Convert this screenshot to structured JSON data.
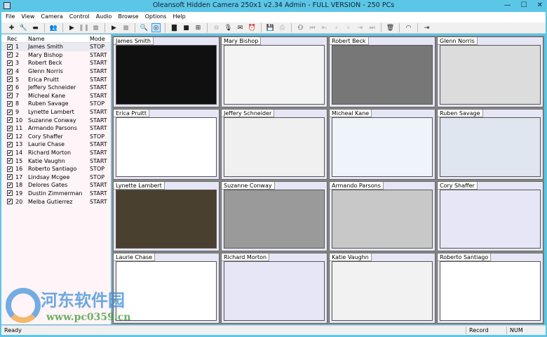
{
  "window": {
    "title": "Oleansoft Hidden Camera 250x1 v2.34 Admin - FULL VERSION - 250 PCs",
    "controls": [
      "—",
      "☐",
      "✕"
    ]
  },
  "menu": [
    "File",
    "View",
    "Camera",
    "Control",
    "Audio",
    "Browse",
    "Options",
    "Help"
  ],
  "toolbar": [
    "add-icon",
    "settings-icon",
    "remove-icon",
    "users-icon",
    "play-icon",
    "pause-icon",
    "stop-icon",
    "play-all-icon",
    "stop-all-icon",
    "zoom-icon",
    "disc-icon",
    "layout-1-icon",
    "layout-small-icon",
    "layout-4-icon",
    "link-icon",
    "microphone-icon",
    "mail-icon",
    "alarm-icon",
    "save-icon",
    "print-icon",
    "binoculars-icon",
    "first-icon",
    "prev-page-icon",
    "prev-icon",
    "next-icon",
    "next-page-icon",
    "last-icon",
    "trash-icon",
    "eye-icon",
    "exit-icon"
  ],
  "list": {
    "headers": [
      "Rec",
      "Name",
      "Mode"
    ],
    "rows": [
      {
        "n": "1",
        "name": "James Smith",
        "mode": "STOP"
      },
      {
        "n": "2",
        "name": "Mary Bishop",
        "mode": "START"
      },
      {
        "n": "3",
        "name": "Robert Beck",
        "mode": "START"
      },
      {
        "n": "4",
        "name": "Glenn Norris",
        "mode": "START"
      },
      {
        "n": "5",
        "name": "Erica Pruitt",
        "mode": "START"
      },
      {
        "n": "6",
        "name": "Jeffery Schneider",
        "mode": "START"
      },
      {
        "n": "7",
        "name": "Micheal Kane",
        "mode": "START"
      },
      {
        "n": "8",
        "name": "Ruben Savage",
        "mode": "STOP"
      },
      {
        "n": "9",
        "name": "Lynette Lambert",
        "mode": "START"
      },
      {
        "n": "10",
        "name": "Suzanne Conway",
        "mode": "START"
      },
      {
        "n": "11",
        "name": "Armando Parsons",
        "mode": "START"
      },
      {
        "n": "12",
        "name": "Cory Shaffer",
        "mode": "STOP"
      },
      {
        "n": "13",
        "name": "Laurie Chase",
        "mode": "START"
      },
      {
        "n": "14",
        "name": "Richard Morton",
        "mode": "START"
      },
      {
        "n": "15",
        "name": "Katie Vaughn",
        "mode": "START"
      },
      {
        "n": "16",
        "name": "Roberto Santiago",
        "mode": "STOP"
      },
      {
        "n": "17",
        "name": "Lindsay Mcgee",
        "mode": "STOP"
      },
      {
        "n": "18",
        "name": "Delores Gates",
        "mode": "START"
      },
      {
        "n": "19",
        "name": "Dustin Zimmerman",
        "mode": "START"
      },
      {
        "n": "20",
        "name": "Melba Gutierrez",
        "mode": "START"
      }
    ]
  },
  "tiles": [
    {
      "name": "James Smith",
      "bg": "#101010"
    },
    {
      "name": "Mary Bishop",
      "bg": "#f4f4f4"
    },
    {
      "name": "Robert Beck",
      "bg": "#777777"
    },
    {
      "name": "Glenn Norris",
      "bg": "#dcdcdc"
    },
    {
      "name": "Erica Pruitt",
      "bg": "#ffffff"
    },
    {
      "name": "Jeffery Schneider",
      "bg": "#f0f0f0"
    },
    {
      "name": "Micheal Kane",
      "bg": "#eef4fa"
    },
    {
      "name": "Ruben Savage",
      "bg": "#dfe6ef"
    },
    {
      "name": "Lynette Lambert",
      "bg": "#4a4030"
    },
    {
      "name": "Suzanne Conway",
      "bg": "#9a9a9a"
    },
    {
      "name": "Armando Parsons",
      "bg": "#c8c8c8"
    },
    {
      "name": "Cory Shaffer",
      "bg": "#e6e6f6"
    },
    {
      "name": "Laurie Chase",
      "bg": "#ffffff"
    },
    {
      "name": "Richard Morton",
      "bg": "#e6e6f6"
    },
    {
      "name": "Katie Vaughn",
      "bg": "#f2f2f2"
    },
    {
      "name": "Roberto Santiago",
      "bg": "#ffffff"
    }
  ],
  "status": {
    "text": "Ready",
    "record": "Record",
    "num": "NUM"
  },
  "watermark": {
    "title": "河东软件园",
    "url": "www.pc0359.cn"
  }
}
